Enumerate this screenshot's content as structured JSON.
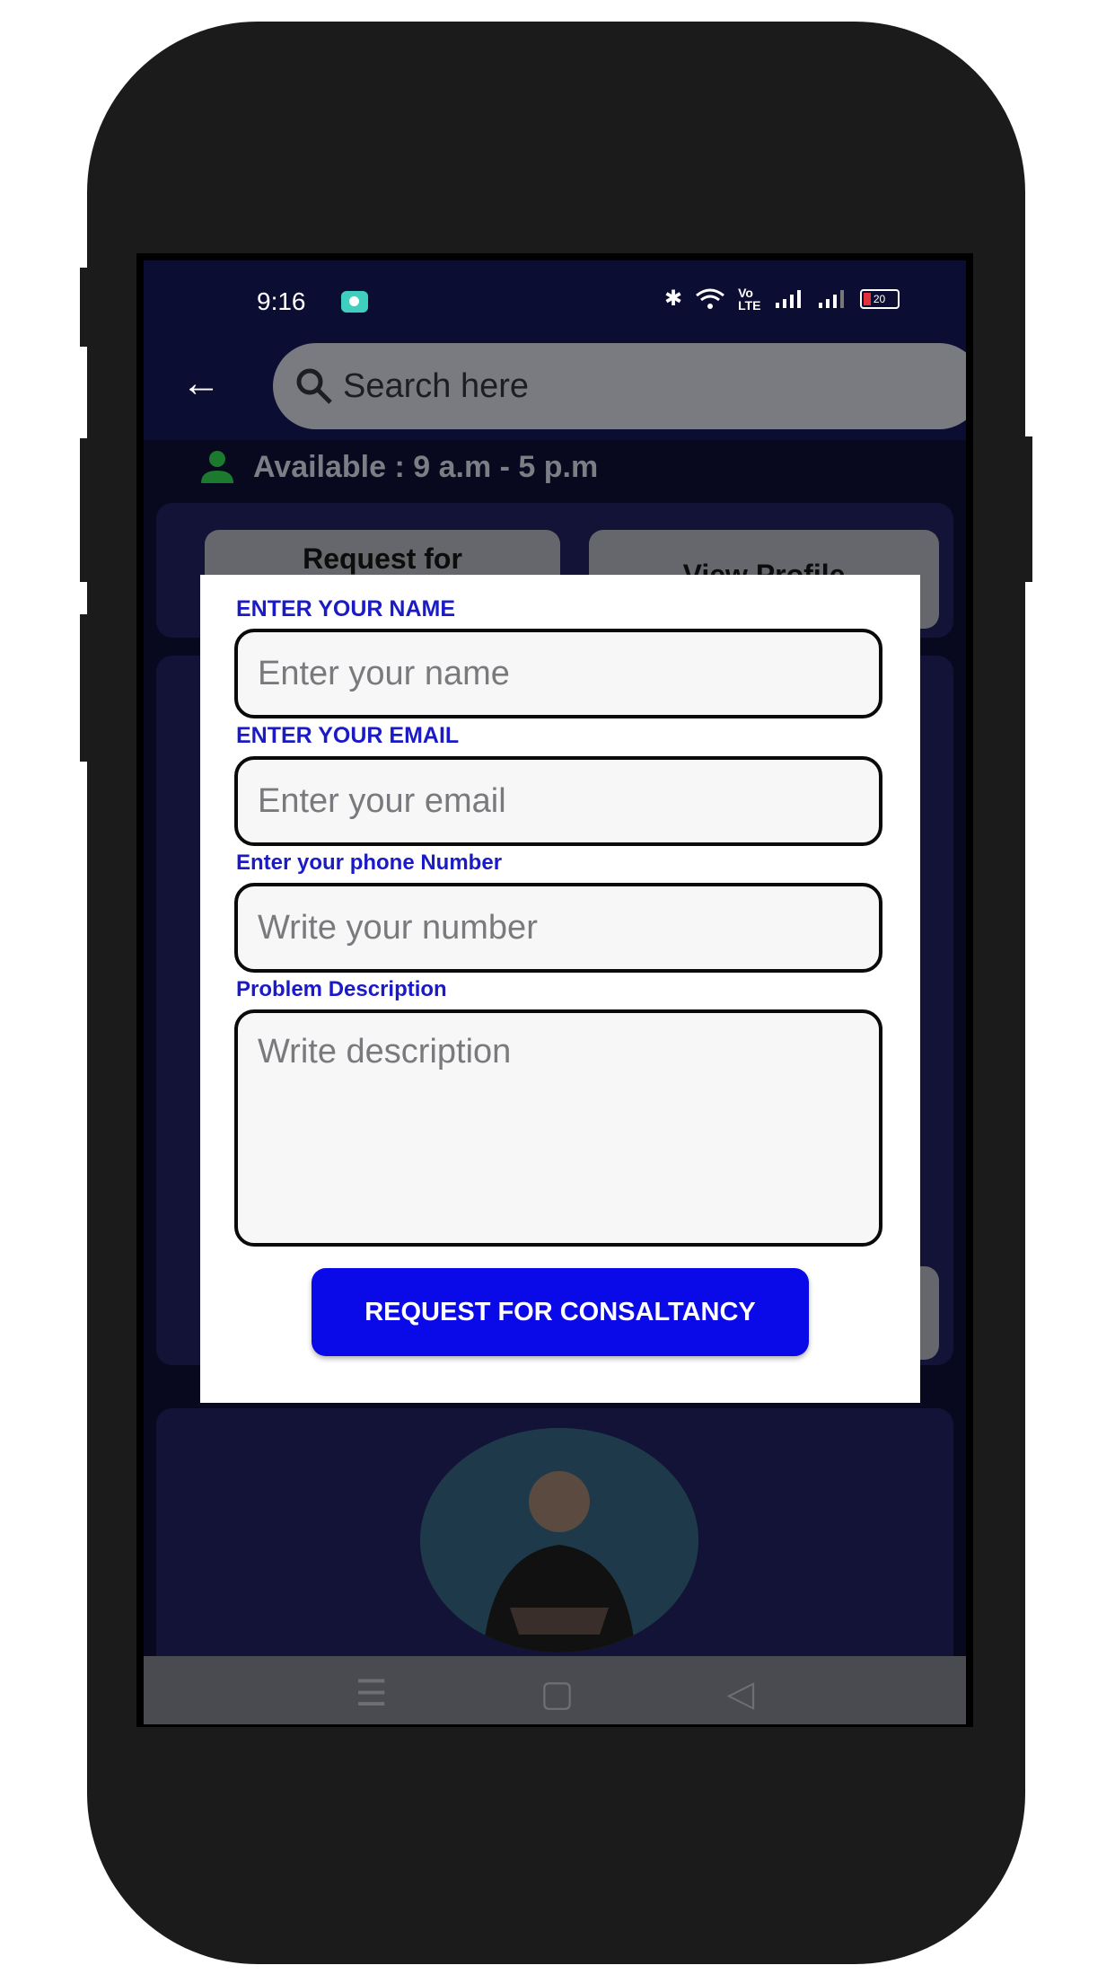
{
  "status_bar": {
    "time": "9:16",
    "battery": "20"
  },
  "header": {
    "search_placeholder": "Search here"
  },
  "background": {
    "availability": "Available :   9 a.m - 5 p.m",
    "request_button": "Request for",
    "view_profile_button": "View Profile"
  },
  "modal": {
    "name_label": "ENTER YOUR NAME",
    "name_placeholder": "Enter your name",
    "email_label": "ENTER YOUR EMAIL",
    "email_placeholder": "Enter your email",
    "phone_label": "Enter your phone Number",
    "phone_placeholder": "Write your number",
    "description_label": "Problem Description",
    "description_placeholder": "Write description",
    "submit_label": "REQUEST FOR CONSALTANCY"
  },
  "colors": {
    "label_blue": "#1a1bc7",
    "button_blue": "#0a0ae8",
    "screen_bg": "#0c0d33"
  }
}
